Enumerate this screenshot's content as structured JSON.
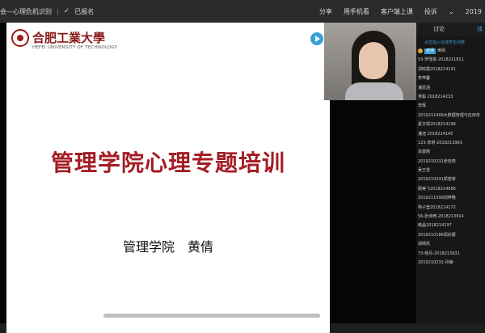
{
  "topbar": {
    "title": "会—心理危机识别",
    "status": "已报名",
    "actions": [
      "分享",
      "用手机看",
      "客户端上课",
      "投诉"
    ],
    "right_text": "2019"
  },
  "slide": {
    "logo_cn": "合肥工業大學",
    "logo_en": "HEFEI UNIVERSITY OF TECHNOLOGY",
    "heading": "管理学院心理专题培训",
    "subtitle": "管理学院　黄倩"
  },
  "sidebar": {
    "tab_discuss": "讨论",
    "tab_other": "成",
    "join_hint": "点击加入在线学生列表",
    "teacher_tag": "老师",
    "teacher_name": "黄倩",
    "participants": [
      "53-罗瑾雯-2018211811",
      "郑晗露2018214141",
      "李梓馨",
      "潘思涵",
      "吴聪 2018214233",
      "李辉",
      "2019211409大数据管理与应用单",
      "夏文琛2018214196",
      "潘浩 2018214145",
      "123-李玥-2018213963",
      "袁康丽",
      "2019210231张佳燕",
      "吴王雪",
      "2019210241郭若菲",
      "顾美飞2018214066",
      "2019211599闻梓略",
      "杨子莹2018214172",
      "56-张诗琦-2018213914",
      "韩晶2018214197",
      "2019210186闻欣蕾",
      "胡晴凯",
      "73-杨丹-2018213931",
      "2019210232-孙静"
    ]
  }
}
